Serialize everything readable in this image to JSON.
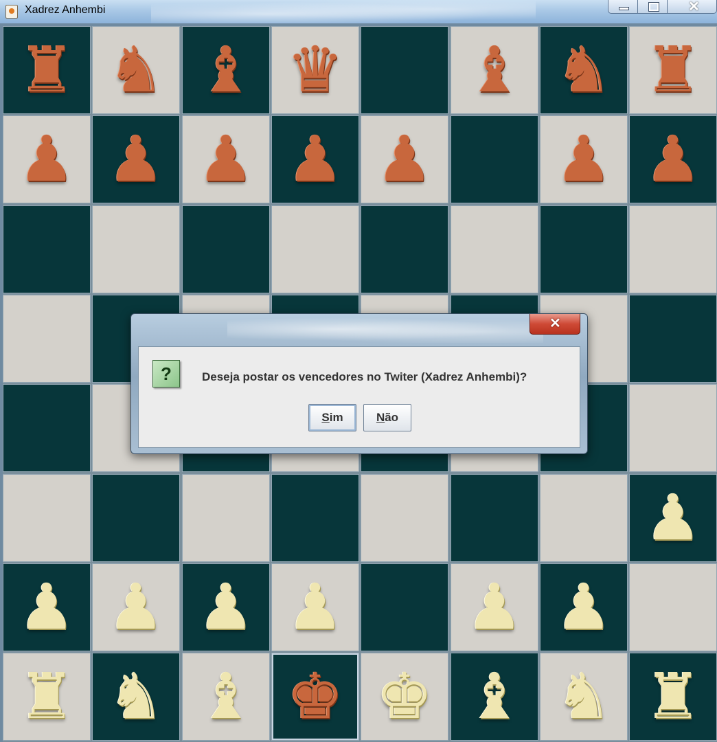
{
  "window": {
    "title": "Xadrez Anhembi",
    "close_glyph": "✕"
  },
  "board": {
    "light_color": "#d4d1cb",
    "dark_color": "#07363a",
    "black_piece_color": "#c8673d",
    "white_piece_color": "#efe6b1",
    "selected_square": "d1",
    "ranks": [
      [
        "bR",
        "bN",
        "bB",
        "bQ",
        "",
        "bB",
        "bN",
        "bR"
      ],
      [
        "bP",
        "bP",
        "bP",
        "bP",
        "bP",
        "",
        "bP",
        "bP"
      ],
      [
        "",
        "",
        "",
        "",
        "",
        "",
        "",
        ""
      ],
      [
        "",
        "",
        "",
        "",
        "",
        "",
        "",
        ""
      ],
      [
        "",
        "",
        "",
        "",
        "",
        "",
        "",
        ""
      ],
      [
        "",
        "",
        "",
        "",
        "",
        "",
        "",
        "wP"
      ],
      [
        "wP",
        "wP",
        "wP",
        "wP",
        "",
        "wP",
        "wP",
        ""
      ],
      [
        "wR",
        "wN",
        "wB",
        "bK",
        "wK",
        "wB",
        "wN",
        "wR"
      ]
    ]
  },
  "dialog": {
    "icon": "question-icon",
    "icon_glyph": "?",
    "message": "Deseja postar os vencedores no Twiter (Xadrez Anhembi)?",
    "close_glyph": "✕",
    "yes_mnemonic": "S",
    "yes_rest": "im",
    "no_mnemonic": "N",
    "no_rest": "ão"
  }
}
